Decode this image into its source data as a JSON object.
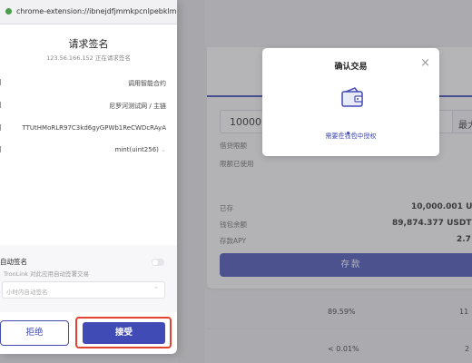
{
  "extension": {
    "url": "chrome-extension://ibnejdfjmmkpcnlpebklmn...",
    "title": "请求签名",
    "subtitle": "123.56.166.152 正在请求签名",
    "rows": [
      {
        "value": "调用智能合约"
      },
      {
        "value": "尼罗河测试网 / 主链"
      },
      {
        "value": "TTUtHMoRLR97C3kd6gyGPWb1ReCWDcRAyA"
      },
      {
        "value": "mint(uint256)"
      }
    ],
    "auto_sign": {
      "title": "自动签名",
      "description": "TronLink 对此应用自动签署交易",
      "select_placeholder": "小时内自动签名"
    },
    "reject_label": "拒绝",
    "accept_label": "接受"
  },
  "confirm_modal": {
    "title": "确认交易",
    "close": "×",
    "message": "需要在钱包中授权"
  },
  "background": {
    "amount": "10000",
    "max_label": "最大",
    "labels": [
      "借贷限额",
      "限额已使用"
    ],
    "stats": [
      {
        "label": "已存",
        "value": "10,000.001 US"
      },
      {
        "label": "钱包余额",
        "value": "89,874.377 USDT"
      },
      {
        "label": "存款APY",
        "value": "2.7"
      }
    ],
    "deposit_label": "存款",
    "table_rows": [
      {
        "apy": "89.59%",
        "value": "11"
      },
      {
        "apy": "< 0.01%",
        "value": "2"
      }
    ]
  },
  "colors": {
    "accent": "#414bb5",
    "highlight": "#e1432e"
  }
}
